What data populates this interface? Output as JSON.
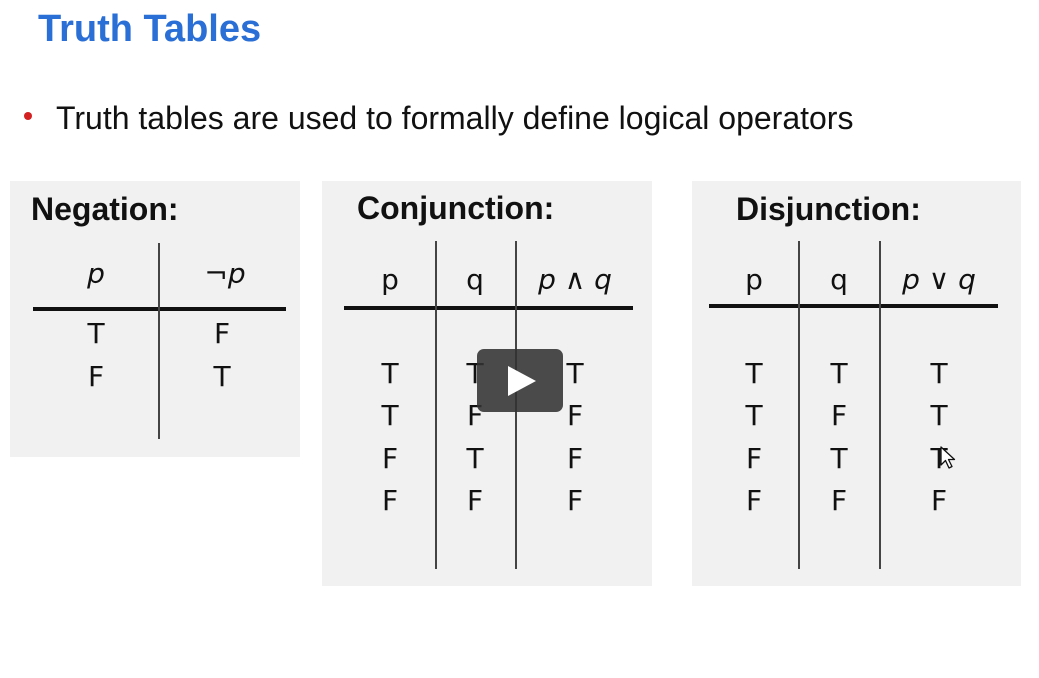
{
  "title": "Truth Tables",
  "bullet": "Truth tables are used to formally define logical operators",
  "colors": {
    "title": "#2a6fd6",
    "bullet": "#d42020",
    "panel_bg": "#f1f1f1"
  },
  "negation": {
    "title": "Negation:",
    "headers": [
      "p",
      "¬p"
    ],
    "rows": [
      [
        "T",
        "F"
      ],
      [
        "F",
        "T"
      ]
    ]
  },
  "conjunction": {
    "title": "Conjunction:",
    "headers": [
      "p",
      "q",
      "p ∧ q"
    ],
    "rows": [
      [
        "T",
        "T",
        "T"
      ],
      [
        "T",
        "F",
        "F"
      ],
      [
        "F",
        "T",
        "F"
      ],
      [
        "F",
        "F",
        "F"
      ]
    ]
  },
  "disjunction": {
    "title": "Disjunction:",
    "headers": [
      "p",
      "q",
      "p ∨ q"
    ],
    "rows": [
      [
        "T",
        "T",
        "T"
      ],
      [
        "T",
        "F",
        "T"
      ],
      [
        "F",
        "T",
        "T"
      ],
      [
        "F",
        "F",
        "F"
      ]
    ]
  },
  "player": {
    "play_icon": "play-icon",
    "cursor_icon": "mouse-cursor-icon"
  }
}
